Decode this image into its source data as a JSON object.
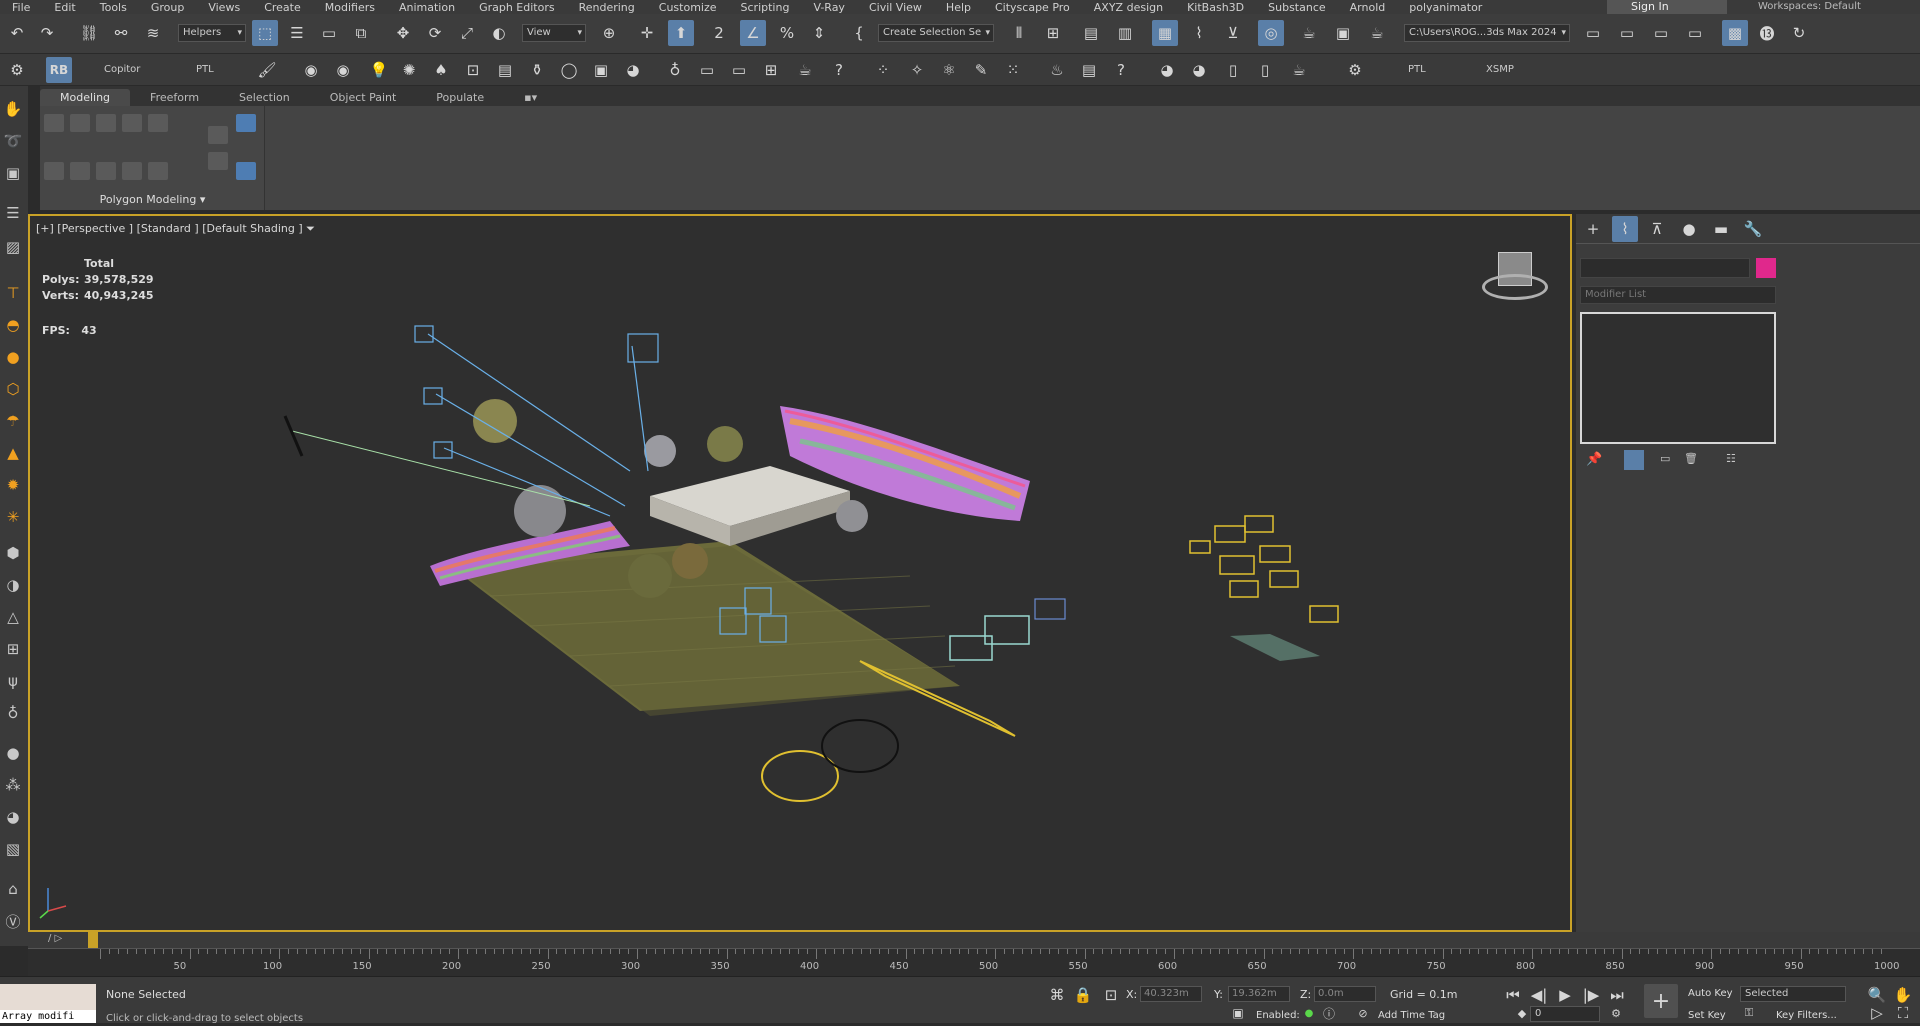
{
  "menu": [
    "File",
    "Edit",
    "Tools",
    "Group",
    "Views",
    "Create",
    "Modifiers",
    "Animation",
    "Graph Editors",
    "Rendering",
    "Customize",
    "Scripting",
    "V-Ray",
    "Civil View",
    "Help",
    "Cityscape Pro",
    "AXYZ design",
    "KitBash3D",
    "Substance",
    "Arnold",
    "polyanimator"
  ],
  "signin": "Sign In",
  "workspace": "Workspaces: Default",
  "toolbar": {
    "selection_set": "Helpers",
    "ref_coord": "View",
    "create_selection_set": "Create Selection Se",
    "project_path": "C:\\Users\\ROG...3ds Max 2024",
    "copitor": "Copitor",
    "ptl1": "PTL",
    "ptl2": "PTL",
    "xsmp": "XSMP"
  },
  "ribbon": {
    "tabs": [
      "Modeling",
      "Freeform",
      "Selection",
      "Object Paint",
      "Populate"
    ],
    "panel_title": "Polygon Modeling"
  },
  "viewport": {
    "label": "[+] [Perspective ] [Standard ] [Default Shading ]",
    "stats_header": "Total",
    "polys_label": "Polys:",
    "polys_value": "39,578,529",
    "verts_label": "Verts:",
    "verts_value": "40,943,245",
    "fps_label": "FPS:",
    "fps_value": "43"
  },
  "cmdpanel": {
    "modifier_list": "Modifier List",
    "object_color": "#e0288c"
  },
  "timeline": {
    "ticks": [
      "50",
      "100",
      "150",
      "200",
      "250",
      "300",
      "350",
      "400",
      "450",
      "500",
      "550",
      "600",
      "650",
      "700",
      "750",
      "800",
      "850",
      "900",
      "950",
      "1000"
    ]
  },
  "status": {
    "maxscript": "Array modifi",
    "selection": "None Selected",
    "prompt": "Click or click-and-drag to select objects",
    "x_label": "X:",
    "x_value": "40.323m",
    "y_label": "Y:",
    "y_value": "19.362m",
    "z_label": "Z:",
    "z_value": "0.0m",
    "grid": "Grid = 0.1m",
    "enabled": "Enabled:",
    "add_time_tag": "Add Time Tag",
    "auto_key": "Auto Key",
    "set_key": "Set Key",
    "selected": "Selected",
    "key_filters": "Key Filters...",
    "frame": "0"
  },
  "colors": {
    "accent_blue": "#5a7fa8",
    "viewport_border": "#c9a227",
    "ground": "#6b6a3a"
  }
}
